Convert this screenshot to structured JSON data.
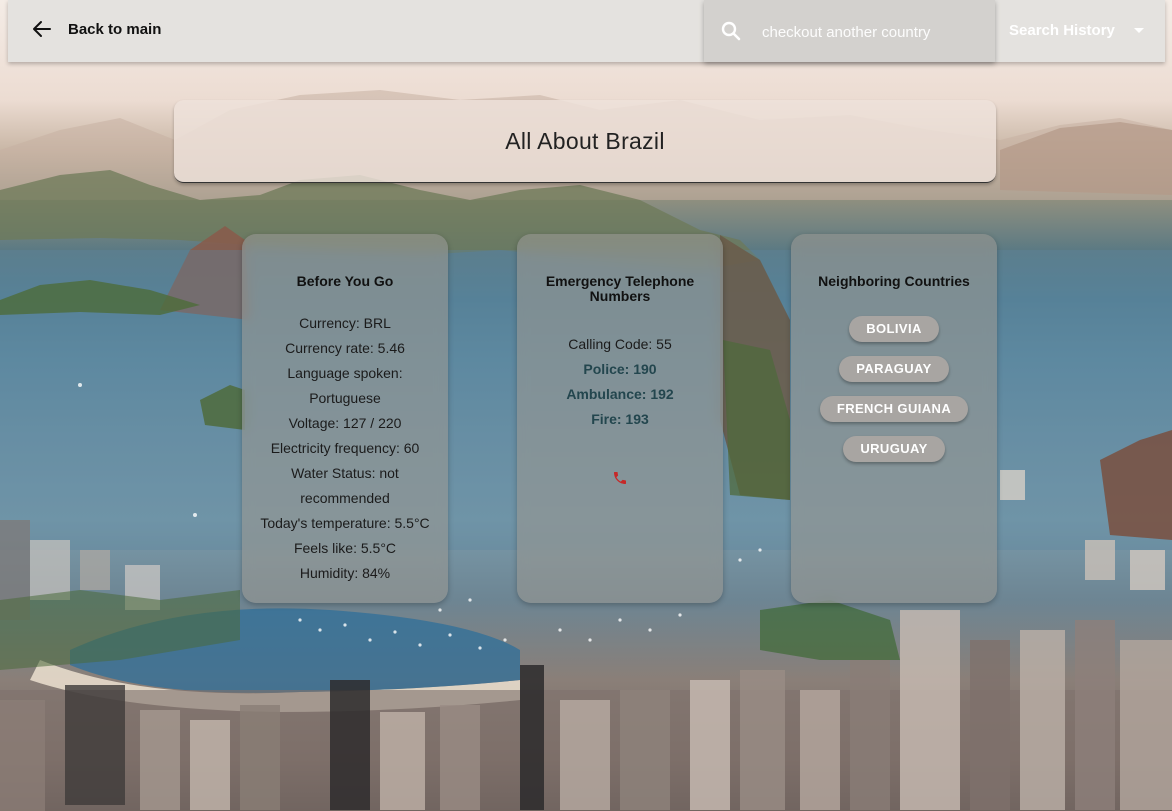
{
  "header": {
    "back_label": "Back to main",
    "search_placeholder": "checkout another country",
    "history_label": "Search History"
  },
  "title": "All About Brazil",
  "before_you_go": {
    "title": "Before You Go",
    "lines": [
      "Currency: BRL",
      "Currency rate: 5.46",
      "Language spoken:",
      "Portuguese",
      "Voltage: 127 / 220",
      "Electricity frequency: 60",
      "Water Status: not",
      "recommended",
      "Today's temperature: 5.5°C",
      "Feels like: 5.5°C",
      "Humidity: 84%"
    ]
  },
  "emergency": {
    "title": "Emergency Telephone Numbers",
    "calling_code": "Calling Code: 55",
    "police": "Police: 190",
    "ambulance": "Ambulance: 192",
    "fire": "Fire: 193",
    "icon": "phone-icon"
  },
  "neighbors": {
    "title": "Neighboring Countries",
    "countries": [
      "BOLIVIA",
      "PARAGUAY",
      "FRENCH GUIANA",
      "URUGUAY"
    ]
  },
  "colors": {
    "accent_text": "#23464e",
    "chip_bg": "#a8a5a2",
    "phone_icon": "#c62828"
  }
}
